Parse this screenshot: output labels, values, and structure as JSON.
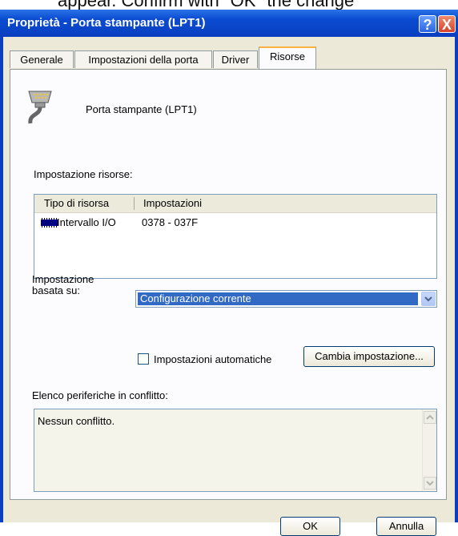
{
  "overlay_text": "appear. Confirm with \"OK\" the change",
  "window": {
    "title": "Proprietà - Porta stampante (LPT1)"
  },
  "titlebar_buttons": {
    "help": "?",
    "close": "X"
  },
  "tabs": [
    "Generale",
    "Impostazioni della porta",
    "Driver",
    "Risorse"
  ],
  "device": {
    "name": "Porta stampante (LPT1)",
    "icon": "printer-port-icon"
  },
  "resources": {
    "label": "Impostazione risorse:",
    "columns": [
      "Tipo di risorsa",
      "Impostazioni"
    ],
    "rows": [
      {
        "type": "Intervallo I/O",
        "value": "0378 - 037F",
        "icon": "memory-chip-icon"
      }
    ]
  },
  "setting_based_on": {
    "label_line1": "Impostazione",
    "label_line2": "basata su:",
    "value": "Configurazione corrente"
  },
  "auto_settings": {
    "label": "Impostazioni automatiche",
    "checked": false
  },
  "change_settings_button": "Cambia impostazione...",
  "conflicts": {
    "label": "Elenco periferiche in conflitto:",
    "text": "Nessun conflitto."
  },
  "buttons": {
    "ok": "OK",
    "cancel": "Annulla"
  },
  "colors": {
    "titlebar": "#0a3fbf",
    "selection": "#316ac5",
    "dialog_bg": "#ece9d8"
  }
}
